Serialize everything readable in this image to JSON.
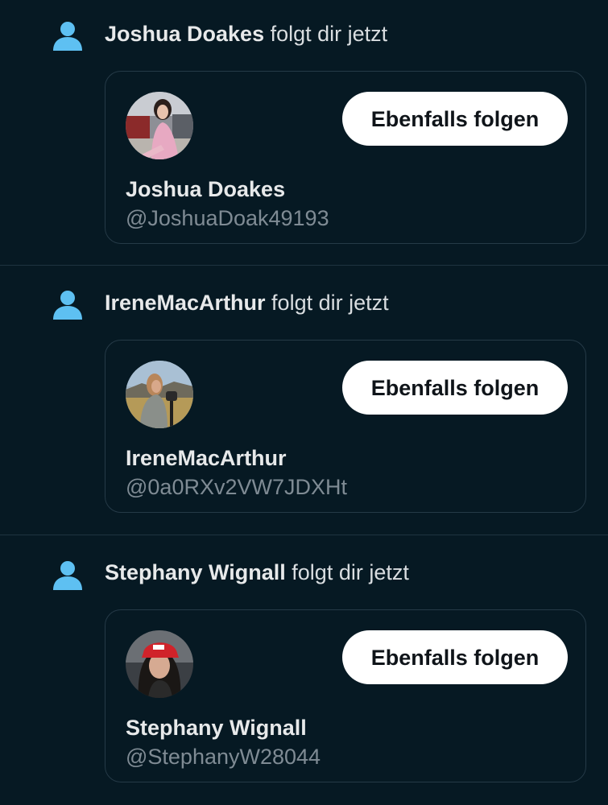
{
  "notifications": [
    {
      "name": "Joshua Doakes",
      "action": " folgt dir jetzt",
      "display_name": "Joshua Doakes",
      "handle": "@JoshuaDoak49193",
      "follow_label": "Ebenfalls folgen",
      "avatar_icon": "avatar-photo-woman-pink-dress"
    },
    {
      "name": "IreneMacArthur",
      "action": " folgt dir jetzt",
      "display_name": "IreneMacArthur",
      "handle": "@0a0RXv2VW7JDXHt",
      "follow_label": "Ebenfalls folgen",
      "avatar_icon": "avatar-photo-woman-outdoors"
    },
    {
      "name": "Stephany Wignall",
      "action": " folgt dir jetzt",
      "display_name": "Stephany Wignall",
      "handle": "@StephanyW28044",
      "follow_label": "Ebenfalls folgen",
      "avatar_icon": "avatar-photo-woman-red-cap"
    }
  ],
  "colors": {
    "background": "#061923",
    "accent_icon": "#5ec0f2",
    "button_bg": "#ffffff",
    "button_text": "#0f1419",
    "handle_text": "#7f8b94",
    "divider": "#1e3340"
  }
}
